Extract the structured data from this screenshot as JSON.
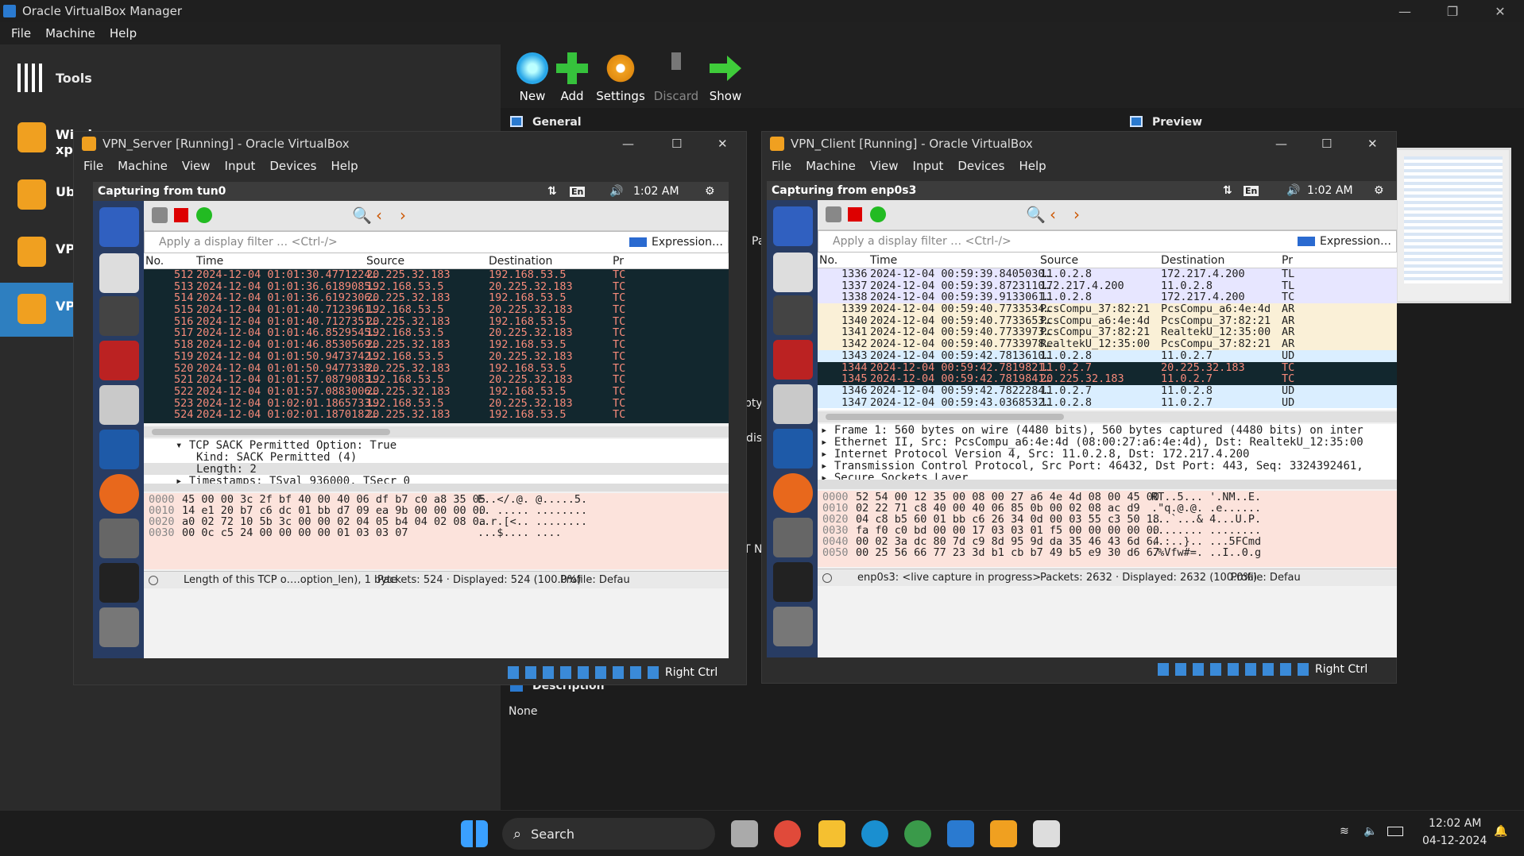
{
  "host": {
    "title": "Oracle VirtualBox Manager",
    "menu": [
      "File",
      "Machine",
      "Help"
    ],
    "tools_label": "Tools",
    "vms": [
      "Windows xp",
      "Ubu",
      "VPN",
      "VPN"
    ],
    "toolbar": {
      "new": "New",
      "add": "Add",
      "settings": "Settings",
      "discard": "Discard",
      "show": "Show"
    },
    "general_label": "General",
    "preview_label": "Preview",
    "description_label": "Description",
    "description_value": "None",
    "partial_labels": [
      "Pa",
      "pty",
      "-dis",
      "T N"
    ]
  },
  "server": {
    "title": "VPN_Server [Running] - Oracle VirtualBox",
    "menu": [
      "File",
      "Machine",
      "View",
      "Input",
      "Devices",
      "Help"
    ],
    "capture_title": "Capturing from tun0",
    "lang": "En",
    "clock": "1:02 AM",
    "filter_placeholder": "Apply a display filter … <Ctrl-/>",
    "expression": "Expression…",
    "columns": [
      "No.",
      "Time",
      "Source",
      "Destination",
      "Pr"
    ],
    "rows": [
      [
        "512",
        "2024-12-04 01:01:30.4771224…",
        "20.225.32.183",
        "192.168.53.5",
        "TC"
      ],
      [
        "513",
        "2024-12-04 01:01:36.6189085…",
        "192.168.53.5",
        "20.225.32.183",
        "TC"
      ],
      [
        "514",
        "2024-12-04 01:01:36.6192306…",
        "20.225.32.183",
        "192.168.53.5",
        "TC"
      ],
      [
        "515",
        "2024-12-04 01:01:40.7123961…",
        "192.168.53.5",
        "20.225.32.183",
        "TC"
      ],
      [
        "516",
        "2024-12-04 01:01:40.7127351…",
        "20.225.32.183",
        "192.168.53.5",
        "TC"
      ],
      [
        "517",
        "2024-12-04 01:01:46.8529545…",
        "192.168.53.5",
        "20.225.32.183",
        "TC"
      ],
      [
        "518",
        "2024-12-04 01:01:46.8530569…",
        "20.225.32.183",
        "192.168.53.5",
        "TC"
      ],
      [
        "519",
        "2024-12-04 01:01:50.9473742…",
        "192.168.53.5",
        "20.225.32.183",
        "TC"
      ],
      [
        "520",
        "2024-12-04 01:01:50.9477338…",
        "20.225.32.183",
        "192.168.53.5",
        "TC"
      ],
      [
        "521",
        "2024-12-04 01:01:57.0879083…",
        "192.168.53.5",
        "20.225.32.183",
        "TC"
      ],
      [
        "522",
        "2024-12-04 01:01:57.0883006…",
        "20.225.32.183",
        "192.168.53.5",
        "TC"
      ],
      [
        "523",
        "2024-12-04 01:02:01.1865733…",
        "192.168.53.5",
        "20.225.32.183",
        "TC"
      ],
      [
        "524",
        "2024-12-04 01:02:01.1870182…",
        "20.225.32.183",
        "192.168.53.5",
        "TC"
      ]
    ],
    "details": [
      "▾ TCP SACK Permitted Option: True",
      "Kind: SACK Permitted (4)",
      "Length: 2",
      "▸ Timestamps: TSval 936000, TSecr 0"
    ],
    "hex": [
      [
        "0000",
        "45 00 00 3c 2f bf 40 00  40 06 df b7 c0 a8 35 05",
        "E..</.@. @.....5."
      ],
      [
        "0010",
        "14 e1 20 b7 c6 dc 01 bb  d7 09 ea 9b 00 00 00 00",
        ".. ..... ........"
      ],
      [
        "0020",
        "a0 02 72 10 5b 3c 00 00  02 04 05 b4 04 02 08 0a",
        "..r.[<.. ........"
      ],
      [
        "0030",
        "00 0c c5 24 00 00 00 00  01 03 03 07",
        "...$.... ...."
      ]
    ],
    "status_left": "Length of this TCP o….option_len), 1 byte",
    "status_packets": "Packets: 524 · Displayed: 524 (100.0%)",
    "status_profile": "Profile: Defau",
    "host_key": "Right Ctrl"
  },
  "client": {
    "title": "VPN_Client [Running] - Oracle VirtualBox",
    "menu": [
      "File",
      "Machine",
      "View",
      "Input",
      "Devices",
      "Help"
    ],
    "capture_title": "Capturing from enp0s3",
    "lang": "En",
    "clock": "1:02 AM",
    "filter_placeholder": "Apply a display filter … <Ctrl-/>",
    "expression": "Expression…",
    "columns": [
      "No.",
      "Time",
      "Source",
      "Destination",
      "Pr"
    ],
    "rows": [
      [
        "1336",
        "2024-12-04 00:59:39.8405030…",
        "11.0.2.8",
        "172.217.4.200",
        "TL"
      ],
      [
        "1337",
        "2024-12-04 00:59:39.8723110…",
        "172.217.4.200",
        "11.0.2.8",
        "TL"
      ],
      [
        "1338",
        "2024-12-04 00:59:39.9133061…",
        "11.0.2.8",
        "172.217.4.200",
        "TC"
      ],
      [
        "1339",
        "2024-12-04 00:59:40.7733534…",
        "PcsCompu_37:82:21",
        "PcsCompu_a6:4e:4d",
        "AR"
      ],
      [
        "1340",
        "2024-12-04 00:59:40.7733653…",
        "PcsCompu_a6:4e:4d",
        "PcsCompu_37:82:21",
        "AR"
      ],
      [
        "1341",
        "2024-12-04 00:59:40.7733973…",
        "PcsCompu_37:82:21",
        "RealtekU_12:35:00",
        "AR"
      ],
      [
        "1342",
        "2024-12-04 00:59:40.7733978…",
        "RealtekU_12:35:00",
        "PcsCompu_37:82:21",
        "AR"
      ],
      [
        "1343",
        "2024-12-04 00:59:42.7813610…",
        "11.0.2.8",
        "11.0.2.7",
        "UD"
      ],
      [
        "1344",
        "2024-12-04 00:59:42.7819821…",
        "11.0.2.7",
        "20.225.32.183",
        "TC"
      ],
      [
        "1345",
        "2024-12-04 00:59:42.7819841…",
        "20.225.32.183",
        "11.0.2.7",
        "TC"
      ],
      [
        "1346",
        "2024-12-04 00:59:42.7822284…",
        "11.0.2.7",
        "11.0.2.8",
        "UD"
      ],
      [
        "1347",
        "2024-12-04 00:59:43.0368532…",
        "11.0.2.8",
        "11.0.2.7",
        "UD"
      ]
    ],
    "details": [
      "▸ Frame 1: 560 bytes on wire (4480 bits), 560 bytes captured (4480 bits) on inter",
      "▸ Ethernet II, Src: PcsCompu_a6:4e:4d (08:00:27:a6:4e:4d), Dst: RealtekU_12:35:00",
      "▸ Internet Protocol Version 4, Src: 11.0.2.8, Dst: 172.217.4.200",
      "▸ Transmission Control Protocol, Src Port: 46432, Dst Port: 443, Seq: 3324392461,",
      "▸ Secure Sockets Layer"
    ],
    "hex": [
      [
        "0000",
        "52 54 00 12 35 00 08 00  27 a6 4e 4d 08 00 45 00",
        "RT..5... '.NM..E."
      ],
      [
        "0010",
        "02 22 71 c8 40 00 40 06  85 0b 00 02 08 ac d9",
        ".\"q.@.@. .e......"
      ],
      [
        "0020",
        "04 c8 b5 60 01 bb c6 26  34 0d 00 03 55 c3 50 18",
        "...`...& 4...U.P."
      ],
      [
        "0030",
        "fa f0 c0 bd 00 00 17 03  03 01 f5 00 00 00 00 00",
        "........ ........"
      ],
      [
        "0040",
        "00 02 3a dc 80 7d c9 8d  95 9d da 35 46 43 6d 64",
        "..:..}.. ...5FCmd"
      ],
      [
        "0050",
        "00 25 56 66 77 23 3d b1  cb b7 49 b5 e9 30 d6 67",
        ".%Vfw#=. ..I..0.g"
      ]
    ],
    "status_left": "enp0s3: <live capture in progress>",
    "status_packets": "Packets: 2632 · Displayed: 2632 (100.0%)",
    "status_profile": "Profile: Defau",
    "host_key": "Right Ctrl"
  },
  "taskbar": {
    "search": "Search",
    "time": "12:02 AM",
    "date": "04-12-2024"
  }
}
